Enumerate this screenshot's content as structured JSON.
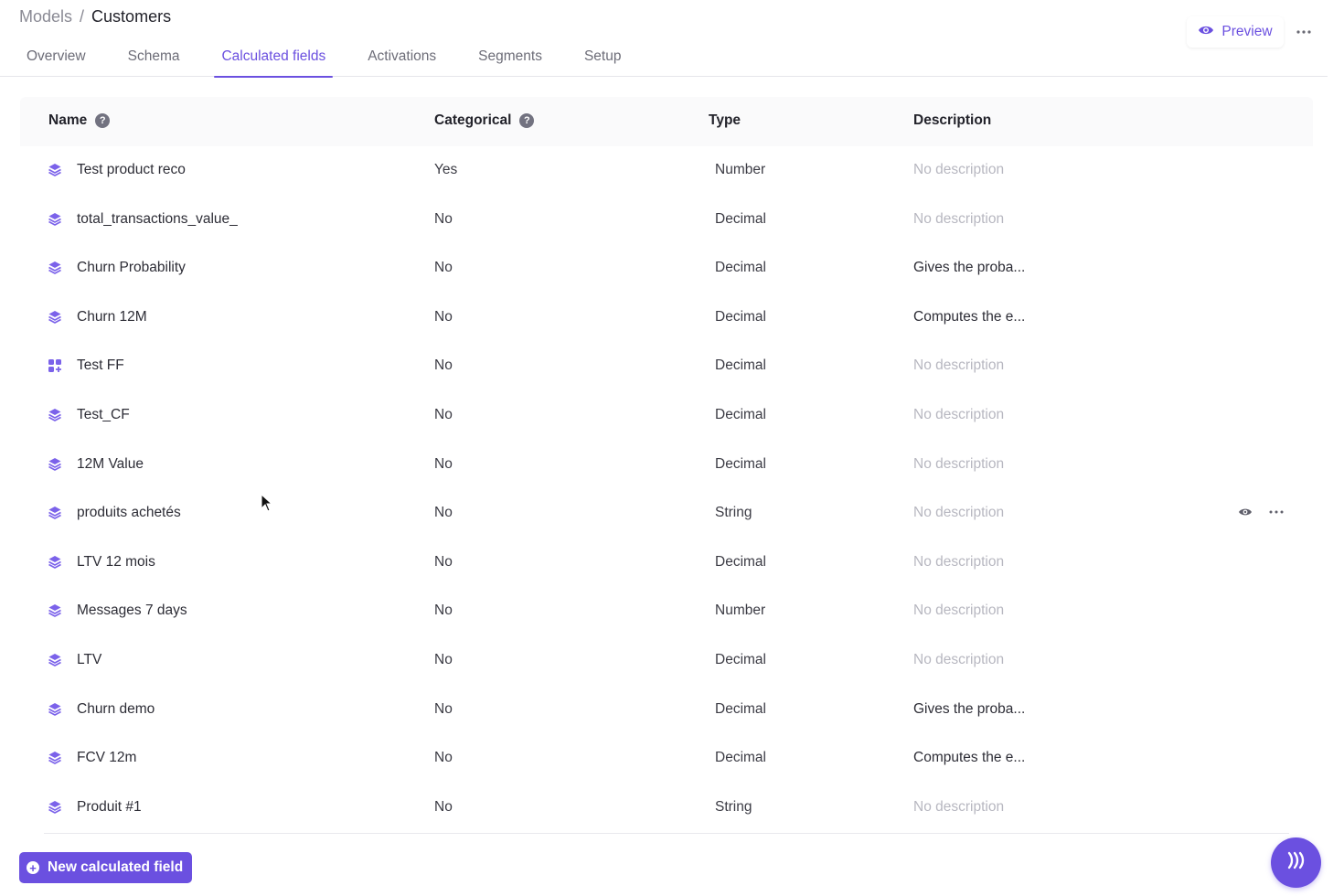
{
  "breadcrumb": {
    "parent": "Models",
    "separator": "/",
    "current": "Customers"
  },
  "tabs": [
    {
      "label": "Overview",
      "active": false
    },
    {
      "label": "Schema",
      "active": false
    },
    {
      "label": "Calculated fields",
      "active": true
    },
    {
      "label": "Activations",
      "active": false
    },
    {
      "label": "Segments",
      "active": false
    },
    {
      "label": "Setup",
      "active": false
    }
  ],
  "header_actions": {
    "preview_label": "Preview",
    "preview_icon": "eye-icon",
    "more_icon": "ellipsis-icon"
  },
  "table": {
    "headers": {
      "name": "Name",
      "categorical": "Categorical",
      "type": "Type",
      "description": "Description"
    },
    "help_icon": "?",
    "rows": [
      {
        "icon": "layers-icon",
        "name": "Test product reco",
        "categorical": "Yes",
        "type": "Number",
        "description": "No description",
        "has_description": false
      },
      {
        "icon": "layers-icon",
        "name": "total_transactions_value_",
        "categorical": "No",
        "type": "Decimal",
        "description": "No description",
        "has_description": false
      },
      {
        "icon": "layers-icon",
        "name": "Churn Probability",
        "categorical": "No",
        "type": "Decimal",
        "description": "Gives the proba...",
        "has_description": true
      },
      {
        "icon": "layers-icon",
        "name": "Churn 12M",
        "categorical": "No",
        "type": "Decimal",
        "description": "Computes the e...",
        "has_description": true
      },
      {
        "icon": "grid-icon",
        "name": "Test FF",
        "categorical": "No",
        "type": "Decimal",
        "description": "No description",
        "has_description": false
      },
      {
        "icon": "layers-icon",
        "name": "Test_CF",
        "categorical": "No",
        "type": "Decimal",
        "description": "No description",
        "has_description": false
      },
      {
        "icon": "layers-icon",
        "name": "12M Value",
        "categorical": "No",
        "type": "Decimal",
        "description": "No description",
        "has_description": false
      },
      {
        "icon": "layers-icon",
        "name": "produits achetés",
        "categorical": "No",
        "type": "String",
        "description": "No description",
        "has_description": false,
        "hovered": true
      },
      {
        "icon": "layers-icon",
        "name": "LTV 12 mois",
        "categorical": "No",
        "type": "Decimal",
        "description": "No description",
        "has_description": false
      },
      {
        "icon": "layers-icon",
        "name": "Messages 7 days",
        "categorical": "No",
        "type": "Number",
        "description": "No description",
        "has_description": false
      },
      {
        "icon": "layers-icon",
        "name": "LTV",
        "categorical": "No",
        "type": "Decimal",
        "description": "No description",
        "has_description": false
      },
      {
        "icon": "layers-icon",
        "name": "Churn demo",
        "categorical": "No",
        "type": "Decimal",
        "description": "Gives the proba...",
        "has_description": true
      },
      {
        "icon": "layers-icon",
        "name": "FCV 12m",
        "categorical": "No",
        "type": "Decimal",
        "description": "Computes the e...",
        "has_description": true
      },
      {
        "icon": "layers-icon",
        "name": "Produit #1",
        "categorical": "No",
        "type": "String",
        "description": "No description",
        "has_description": false
      }
    ]
  },
  "footer": {
    "new_button_label": "New calculated field",
    "new_button_icon": "plus-circle-icon",
    "chat_icon": "assistant-waves-icon"
  },
  "colors": {
    "accent": "#6b50e0",
    "muted_text": "#b7b7c0",
    "text": "#2d2d36",
    "header_bg": "#fafafb"
  }
}
